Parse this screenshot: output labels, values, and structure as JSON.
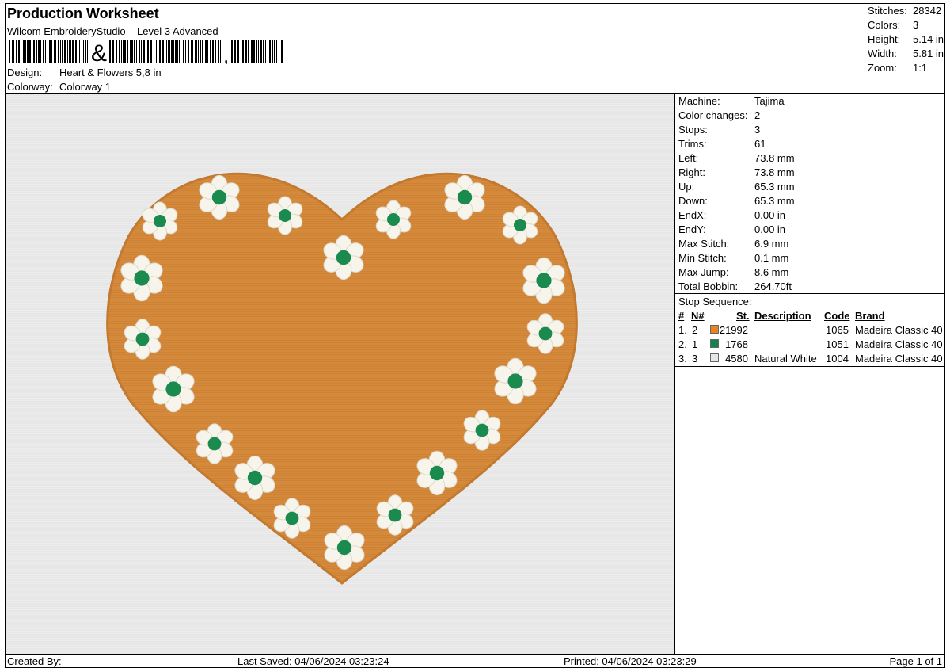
{
  "header": {
    "title": "Production Worksheet",
    "software": "Wilcom EmbroideryStudio – Level 3 Advanced",
    "design_label": "Design:",
    "design_value": "Heart & Flowers 5,8 in",
    "colorway_label": "Colorway:",
    "colorway_value": "Colorway 1"
  },
  "stats": [
    {
      "label": "Stitches:",
      "value": "28342"
    },
    {
      "label": "Colors:",
      "value": "3"
    },
    {
      "label": "Height:",
      "value": "5.14 in"
    },
    {
      "label": "Width:",
      "value": "5.81 in"
    },
    {
      "label": "Zoom:",
      "value": "1:1"
    }
  ],
  "specs": [
    {
      "label": "Machine:",
      "value": "Tajima"
    },
    {
      "label": "Color changes:",
      "value": "2"
    },
    {
      "label": "Stops:",
      "value": "3"
    },
    {
      "label": "Trims:",
      "value": "61"
    },
    {
      "label": "Left:",
      "value": "73.8 mm"
    },
    {
      "label": "Right:",
      "value": "73.8 mm"
    },
    {
      "label": "Up:",
      "value": "65.3 mm"
    },
    {
      "label": "Down:",
      "value": "65.3 mm"
    },
    {
      "label": "EndX:",
      "value": "0.00 in"
    },
    {
      "label": "EndY:",
      "value": "0.00 in"
    },
    {
      "label": "Max Stitch:",
      "value": "6.9 mm"
    },
    {
      "label": "Min Stitch:",
      "value": "0.1 mm"
    },
    {
      "label": "Max Jump:",
      "value": "8.6 mm"
    },
    {
      "label": "Total Bobbin:",
      "value": "264.70ft"
    }
  ],
  "stop_sequence": {
    "title": "Stop Sequence:",
    "columns": [
      "#",
      "N#",
      "St.",
      "Description",
      "Code",
      "Brand"
    ],
    "rows": [
      {
        "idx": "1.",
        "n": "2",
        "color": "#e98321",
        "st": "21992",
        "description": "",
        "code": "1065",
        "brand": "Madeira Classic 40"
      },
      {
        "idx": "2.",
        "n": "1",
        "color": "#11864c",
        "st": "1768",
        "description": "",
        "code": "1051",
        "brand": "Madeira Classic 40"
      },
      {
        "idx": "3.",
        "n": "3",
        "color": "#e6e6ea",
        "st": "4580",
        "description": "Natural White",
        "code": "1004",
        "brand": "Madeira Classic 40"
      }
    ]
  },
  "design_colors": {
    "fabric": "#ececec",
    "heart_fill": "#d5893a",
    "heart_edge": "#c27930",
    "petal": "#f7f4ec",
    "petal_shade": "#ded9cc",
    "center": "#1b8a4e"
  },
  "footer": {
    "created_by": "Created By:",
    "last_saved": "Last Saved: 04/06/2024 03:23:24",
    "printed": "Printed: 04/06/2024 03:23:29",
    "page": "Page 1 of 1"
  }
}
